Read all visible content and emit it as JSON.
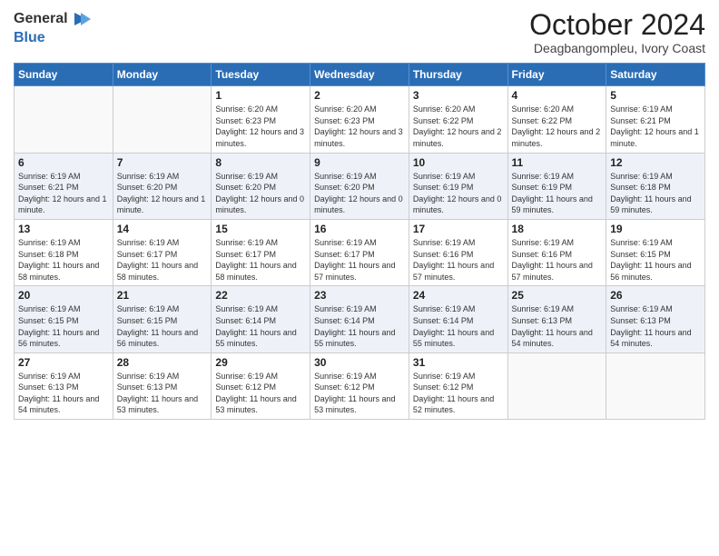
{
  "header": {
    "logo_line1": "General",
    "logo_line2": "Blue",
    "month": "October 2024",
    "location": "Deagbangompleu, Ivory Coast"
  },
  "weekdays": [
    "Sunday",
    "Monday",
    "Tuesday",
    "Wednesday",
    "Thursday",
    "Friday",
    "Saturday"
  ],
  "weeks": [
    [
      {
        "day": "",
        "info": ""
      },
      {
        "day": "",
        "info": ""
      },
      {
        "day": "1",
        "info": "Sunrise: 6:20 AM\nSunset: 6:23 PM\nDaylight: 12 hours and 3 minutes."
      },
      {
        "day": "2",
        "info": "Sunrise: 6:20 AM\nSunset: 6:23 PM\nDaylight: 12 hours and 3 minutes."
      },
      {
        "day": "3",
        "info": "Sunrise: 6:20 AM\nSunset: 6:22 PM\nDaylight: 12 hours and 2 minutes."
      },
      {
        "day": "4",
        "info": "Sunrise: 6:20 AM\nSunset: 6:22 PM\nDaylight: 12 hours and 2 minutes."
      },
      {
        "day": "5",
        "info": "Sunrise: 6:19 AM\nSunset: 6:21 PM\nDaylight: 12 hours and 1 minute."
      }
    ],
    [
      {
        "day": "6",
        "info": "Sunrise: 6:19 AM\nSunset: 6:21 PM\nDaylight: 12 hours and 1 minute."
      },
      {
        "day": "7",
        "info": "Sunrise: 6:19 AM\nSunset: 6:20 PM\nDaylight: 12 hours and 1 minute."
      },
      {
        "day": "8",
        "info": "Sunrise: 6:19 AM\nSunset: 6:20 PM\nDaylight: 12 hours and 0 minutes."
      },
      {
        "day": "9",
        "info": "Sunrise: 6:19 AM\nSunset: 6:20 PM\nDaylight: 12 hours and 0 minutes."
      },
      {
        "day": "10",
        "info": "Sunrise: 6:19 AM\nSunset: 6:19 PM\nDaylight: 12 hours and 0 minutes."
      },
      {
        "day": "11",
        "info": "Sunrise: 6:19 AM\nSunset: 6:19 PM\nDaylight: 11 hours and 59 minutes."
      },
      {
        "day": "12",
        "info": "Sunrise: 6:19 AM\nSunset: 6:18 PM\nDaylight: 11 hours and 59 minutes."
      }
    ],
    [
      {
        "day": "13",
        "info": "Sunrise: 6:19 AM\nSunset: 6:18 PM\nDaylight: 11 hours and 58 minutes."
      },
      {
        "day": "14",
        "info": "Sunrise: 6:19 AM\nSunset: 6:17 PM\nDaylight: 11 hours and 58 minutes."
      },
      {
        "day": "15",
        "info": "Sunrise: 6:19 AM\nSunset: 6:17 PM\nDaylight: 11 hours and 58 minutes."
      },
      {
        "day": "16",
        "info": "Sunrise: 6:19 AM\nSunset: 6:17 PM\nDaylight: 11 hours and 57 minutes."
      },
      {
        "day": "17",
        "info": "Sunrise: 6:19 AM\nSunset: 6:16 PM\nDaylight: 11 hours and 57 minutes."
      },
      {
        "day": "18",
        "info": "Sunrise: 6:19 AM\nSunset: 6:16 PM\nDaylight: 11 hours and 57 minutes."
      },
      {
        "day": "19",
        "info": "Sunrise: 6:19 AM\nSunset: 6:15 PM\nDaylight: 11 hours and 56 minutes."
      }
    ],
    [
      {
        "day": "20",
        "info": "Sunrise: 6:19 AM\nSunset: 6:15 PM\nDaylight: 11 hours and 56 minutes."
      },
      {
        "day": "21",
        "info": "Sunrise: 6:19 AM\nSunset: 6:15 PM\nDaylight: 11 hours and 56 minutes."
      },
      {
        "day": "22",
        "info": "Sunrise: 6:19 AM\nSunset: 6:14 PM\nDaylight: 11 hours and 55 minutes."
      },
      {
        "day": "23",
        "info": "Sunrise: 6:19 AM\nSunset: 6:14 PM\nDaylight: 11 hours and 55 minutes."
      },
      {
        "day": "24",
        "info": "Sunrise: 6:19 AM\nSunset: 6:14 PM\nDaylight: 11 hours and 55 minutes."
      },
      {
        "day": "25",
        "info": "Sunrise: 6:19 AM\nSunset: 6:13 PM\nDaylight: 11 hours and 54 minutes."
      },
      {
        "day": "26",
        "info": "Sunrise: 6:19 AM\nSunset: 6:13 PM\nDaylight: 11 hours and 54 minutes."
      }
    ],
    [
      {
        "day": "27",
        "info": "Sunrise: 6:19 AM\nSunset: 6:13 PM\nDaylight: 11 hours and 54 minutes."
      },
      {
        "day": "28",
        "info": "Sunrise: 6:19 AM\nSunset: 6:13 PM\nDaylight: 11 hours and 53 minutes."
      },
      {
        "day": "29",
        "info": "Sunrise: 6:19 AM\nSunset: 6:12 PM\nDaylight: 11 hours and 53 minutes."
      },
      {
        "day": "30",
        "info": "Sunrise: 6:19 AM\nSunset: 6:12 PM\nDaylight: 11 hours and 53 minutes."
      },
      {
        "day": "31",
        "info": "Sunrise: 6:19 AM\nSunset: 6:12 PM\nDaylight: 11 hours and 52 minutes."
      },
      {
        "day": "",
        "info": ""
      },
      {
        "day": "",
        "info": ""
      }
    ]
  ]
}
